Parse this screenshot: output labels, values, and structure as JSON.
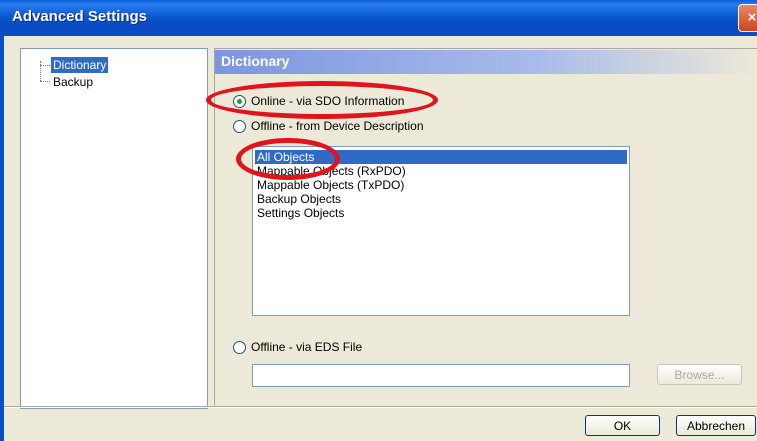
{
  "window": {
    "title": "Advanced Settings",
    "close_glyph": "×"
  },
  "tree": {
    "items": [
      {
        "label": "Dictionary",
        "selected": true
      },
      {
        "label": "Backup",
        "selected": false
      }
    ]
  },
  "panel": {
    "title": "Dictionary",
    "radio_online": "Online - via SDO Information",
    "radio_offline_device": "Offline - from Device Description",
    "radio_offline_eds": "Offline - via EDS File",
    "selected_radio": "online",
    "list_items": [
      "All Objects",
      "Mappable Objects (RxPDO)",
      "Mappable Objects (TxPDO)",
      "Backup Objects",
      "Settings Objects"
    ],
    "selected_list_item": "All Objects",
    "eds_file_value": "",
    "browse_label": "Browse..."
  },
  "buttons": {
    "ok": "OK",
    "cancel": "Abbrechen"
  },
  "annotation": {
    "highlight_color": "#e0141a"
  }
}
